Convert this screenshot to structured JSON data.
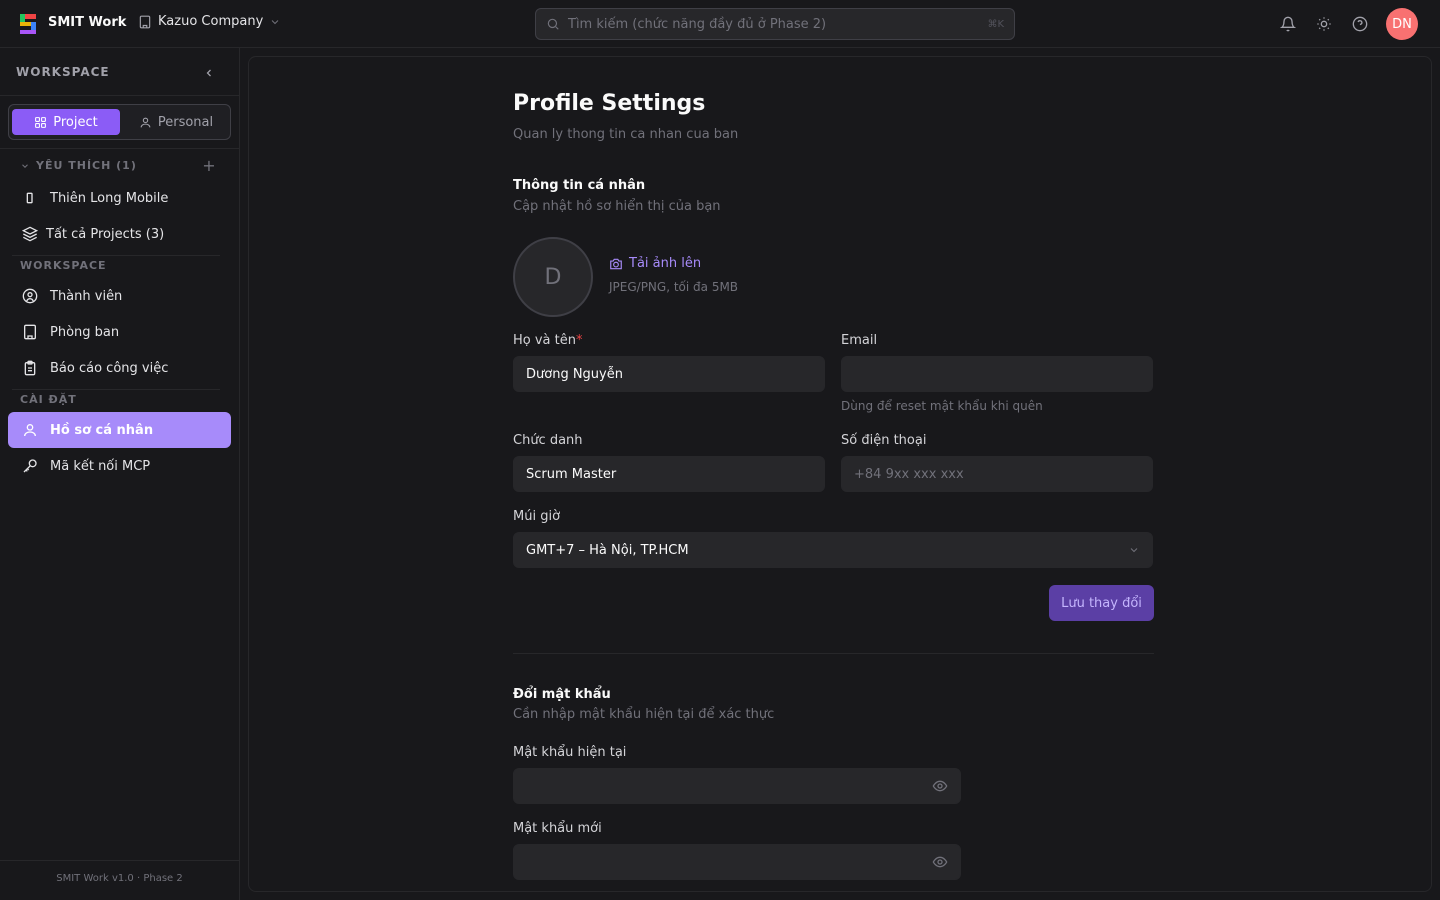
{
  "topbar": {
    "brand": "SMIT Work",
    "company": "Kazuo Company",
    "search_placeholder": "Tìm kiếm (chức năng đầy đủ ở Phase 2)",
    "search_shortcut": "⌘K",
    "user_initials": "DN"
  },
  "sidebar": {
    "workspace_title": "WORKSPACE",
    "tabs": {
      "project": "Project",
      "personal": "Personal"
    },
    "favorites_label": "YÊU THÍCH (1)",
    "favorites": [
      {
        "label": "Thiên Long Mobile"
      },
      {
        "label": "Tất cả Projects (3)"
      }
    ],
    "workspace_group": "WORKSPACE",
    "workspace_items": [
      {
        "label": "Thành viên"
      },
      {
        "label": "Phòng ban"
      },
      {
        "label": "Báo cáo công việc"
      }
    ],
    "settings_group": "CÀI ĐẶT",
    "settings_items": [
      {
        "label": "Hồ sơ cá nhân",
        "active": true
      },
      {
        "label": "Mã kết nối MCP"
      }
    ],
    "footer": "SMIT Work v1.0 · Phase 2"
  },
  "main": {
    "title": "Profile Settings",
    "subtitle": "Quan ly thong tin ca nhan cua ban",
    "personal": {
      "title": "Thông tin cá nhân",
      "subtitle": "Cập nhật hồ sơ hiển thị của bạn",
      "avatar_letter": "D",
      "upload_label": "Tải ảnh lên",
      "upload_hint": "JPEG/PNG, tối đa 5MB",
      "fullname_label": "Họ và tên",
      "fullname_required": "*",
      "fullname_value": "Dương Nguyễn",
      "email_label": "Email",
      "email_value": "",
      "email_hint": "Dùng để reset mật khẩu khi quên",
      "jobtitle_label": "Chức danh",
      "jobtitle_value": "Scrum Master",
      "phone_label": "Số điện thoại",
      "phone_placeholder": "+84 9xx xxx xxx",
      "timezone_label": "Múi giờ",
      "timezone_value": "GMT+7 – Hà Nội, TP.HCM",
      "save_label": "Lưu thay đổi"
    },
    "password": {
      "title": "Đổi mật khẩu",
      "subtitle": "Cần nhập mật khẩu hiện tại để xác thực",
      "current_label": "Mật khẩu hiện tại",
      "new_label": "Mật khẩu mới"
    }
  },
  "colors": {
    "accent": "#8b5cf6",
    "active_nav": "#a78bfa",
    "avatar_bg": "#f87171",
    "background": "#18181b"
  }
}
